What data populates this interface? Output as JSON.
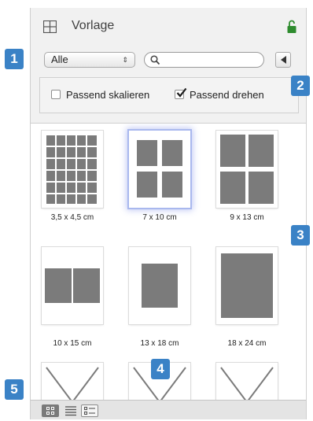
{
  "header": {
    "title": "Vorlage",
    "grid_icon": "grid-icon",
    "lock_icon": "lock-open-icon",
    "lock_color": "#2e8b2e"
  },
  "toolbar": {
    "filter_value": "Alle",
    "filter_arrows": "⇕",
    "search_value": "",
    "search_icon": "search-icon",
    "collapse_icon": "triangle-left-icon"
  },
  "options": {
    "fit_scale_label": "Passend skalieren",
    "fit_scale_checked": false,
    "fit_rotate_label": "Passend drehen",
    "fit_rotate_checked": true
  },
  "templates": [
    {
      "label": "3,5 x 4,5 cm",
      "selected": false
    },
    {
      "label": "7 x 10 cm",
      "selected": true
    },
    {
      "label": "9 x 13 cm",
      "selected": false
    },
    {
      "label": "10 x 15 cm",
      "selected": false
    },
    {
      "label": "13 x 18 cm",
      "selected": false
    },
    {
      "label": "18 x 24 cm",
      "selected": false
    },
    {
      "label": "",
      "selected": false
    },
    {
      "label": "",
      "selected": false
    },
    {
      "label": "",
      "selected": false
    }
  ],
  "view_buttons": [
    "grid-view-icon",
    "list-view-icon",
    "detail-view-icon"
  ],
  "callouts": [
    "1",
    "2",
    "3",
    "4",
    "5"
  ],
  "colors": {
    "callout": "#3a82c6",
    "placeholder": "#7b7b7b",
    "selection_glow": "#a9b8ee"
  }
}
